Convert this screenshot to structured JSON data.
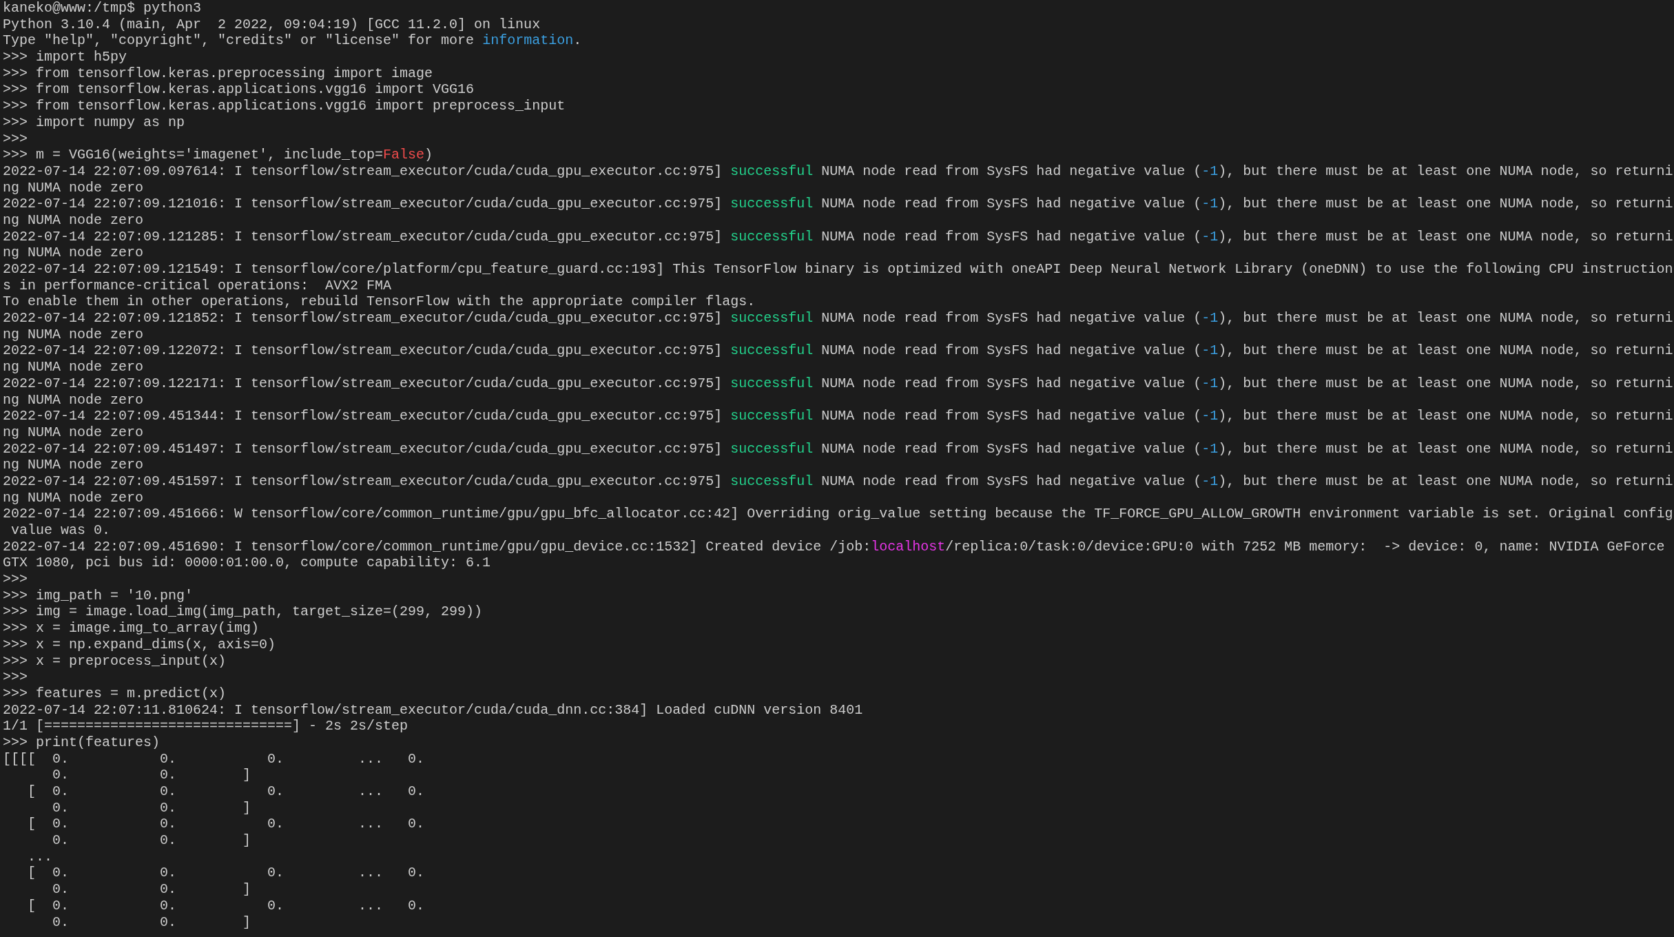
{
  "terminal": {
    "lines": [
      {
        "segments": [
          {
            "text": "kaneko@www:/tmp$ python3"
          }
        ]
      },
      {
        "segments": [
          {
            "text": "Python 3.10.4 (main, Apr  2 2022, 09:04:19) [GCC 11.2.0] on linux"
          }
        ]
      },
      {
        "segments": [
          {
            "text": "Type \"help\", \"copyright\", \"credits\" or \"license\" for more "
          },
          {
            "text": "information",
            "color": "#3b9fe0"
          },
          {
            "text": "."
          }
        ]
      },
      {
        "segments": [
          {
            "text": ">>> import h5py"
          }
        ]
      },
      {
        "segments": [
          {
            "text": ">>> from tensorflow.keras.preprocessing import image"
          }
        ]
      },
      {
        "segments": [
          {
            "text": ">>> from tensorflow.keras.applications.vgg16 import VGG16"
          }
        ]
      },
      {
        "segments": [
          {
            "text": ">>> from tensorflow.keras.applications.vgg16 import preprocess_input"
          }
        ]
      },
      {
        "segments": [
          {
            "text": ">>> import numpy as np"
          }
        ]
      },
      {
        "segments": [
          {
            "text": ">>>"
          }
        ]
      },
      {
        "segments": [
          {
            "text": ">>> m = VGG16(weights='imagenet', include_top="
          },
          {
            "text": "False",
            "color": "#f14c4c"
          },
          {
            "text": ")"
          }
        ]
      },
      {
        "segments": [
          {
            "text": "2022-07-14 22:07:09.097614: I tensorflow/stream_executor/cuda/cuda_gpu_executor.cc:975] "
          },
          {
            "text": "successful",
            "color": "#23d18b"
          },
          {
            "text": " NUMA node read from SysFS had negative value ("
          },
          {
            "text": "-1",
            "color": "#3b9fe0"
          },
          {
            "text": "), but there must be at least one NUMA node, so returni"
          }
        ]
      },
      {
        "segments": [
          {
            "text": "ng NUMA node zero"
          }
        ]
      },
      {
        "segments": [
          {
            "text": "2022-07-14 22:07:09.121016: I tensorflow/stream_executor/cuda/cuda_gpu_executor.cc:975] "
          },
          {
            "text": "successful",
            "color": "#23d18b"
          },
          {
            "text": " NUMA node read from SysFS had negative value ("
          },
          {
            "text": "-1",
            "color": "#3b9fe0"
          },
          {
            "text": "), but there must be at least one NUMA node, so returni"
          }
        ]
      },
      {
        "segments": [
          {
            "text": "ng NUMA node zero"
          }
        ]
      },
      {
        "segments": [
          {
            "text": "2022-07-14 22:07:09.121285: I tensorflow/stream_executor/cuda/cuda_gpu_executor.cc:975] "
          },
          {
            "text": "successful",
            "color": "#23d18b"
          },
          {
            "text": " NUMA node read from SysFS had negative value ("
          },
          {
            "text": "-1",
            "color": "#3b9fe0"
          },
          {
            "text": "), but there must be at least one NUMA node, so returni"
          }
        ]
      },
      {
        "segments": [
          {
            "text": "ng NUMA node zero"
          }
        ]
      },
      {
        "segments": [
          {
            "text": "2022-07-14 22:07:09.121549: I tensorflow/core/platform/cpu_feature_guard.cc:193] This TensorFlow binary is optimized with oneAPI Deep Neural Network Library (oneDNN) to use the following CPU instruction"
          }
        ]
      },
      {
        "segments": [
          {
            "text": "s in performance-critical operations:  AVX2 FMA"
          }
        ]
      },
      {
        "segments": [
          {
            "text": "To enable them in other operations, rebuild TensorFlow with the appropriate compiler flags."
          }
        ]
      },
      {
        "segments": [
          {
            "text": "2022-07-14 22:07:09.121852: I tensorflow/stream_executor/cuda/cuda_gpu_executor.cc:975] "
          },
          {
            "text": "successful",
            "color": "#23d18b"
          },
          {
            "text": " NUMA node read from SysFS had negative value ("
          },
          {
            "text": "-1",
            "color": "#3b9fe0"
          },
          {
            "text": "), but there must be at least one NUMA node, so returni"
          }
        ]
      },
      {
        "segments": [
          {
            "text": "ng NUMA node zero"
          }
        ]
      },
      {
        "segments": [
          {
            "text": "2022-07-14 22:07:09.122072: I tensorflow/stream_executor/cuda/cuda_gpu_executor.cc:975] "
          },
          {
            "text": "successful",
            "color": "#23d18b"
          },
          {
            "text": " NUMA node read from SysFS had negative value ("
          },
          {
            "text": "-1",
            "color": "#3b9fe0"
          },
          {
            "text": "), but there must be at least one NUMA node, so returni"
          }
        ]
      },
      {
        "segments": [
          {
            "text": "ng NUMA node zero"
          }
        ]
      },
      {
        "segments": [
          {
            "text": "2022-07-14 22:07:09.122171: I tensorflow/stream_executor/cuda/cuda_gpu_executor.cc:975] "
          },
          {
            "text": "successful",
            "color": "#23d18b"
          },
          {
            "text": " NUMA node read from SysFS had negative value ("
          },
          {
            "text": "-1",
            "color": "#3b9fe0"
          },
          {
            "text": "), but there must be at least one NUMA node, so returni"
          }
        ]
      },
      {
        "segments": [
          {
            "text": "ng NUMA node zero"
          }
        ]
      },
      {
        "segments": [
          {
            "text": "2022-07-14 22:07:09.451344: I tensorflow/stream_executor/cuda/cuda_gpu_executor.cc:975] "
          },
          {
            "text": "successful",
            "color": "#23d18b"
          },
          {
            "text": " NUMA node read from SysFS had negative value ("
          },
          {
            "text": "-1",
            "color": "#3b9fe0"
          },
          {
            "text": "), but there must be at least one NUMA node, so returni"
          }
        ]
      },
      {
        "segments": [
          {
            "text": "ng NUMA node zero"
          }
        ]
      },
      {
        "segments": [
          {
            "text": "2022-07-14 22:07:09.451497: I tensorflow/stream_executor/cuda/cuda_gpu_executor.cc:975] "
          },
          {
            "text": "successful",
            "color": "#23d18b"
          },
          {
            "text": " NUMA node read from SysFS had negative value ("
          },
          {
            "text": "-1",
            "color": "#3b9fe0"
          },
          {
            "text": "), but there must be at least one NUMA node, so returni"
          }
        ]
      },
      {
        "segments": [
          {
            "text": "ng NUMA node zero"
          }
        ]
      },
      {
        "segments": [
          {
            "text": "2022-07-14 22:07:09.451597: I tensorflow/stream_executor/cuda/cuda_gpu_executor.cc:975] "
          },
          {
            "text": "successful",
            "color": "#23d18b"
          },
          {
            "text": " NUMA node read from SysFS had negative value ("
          },
          {
            "text": "-1",
            "color": "#3b9fe0"
          },
          {
            "text": "), but there must be at least one NUMA node, so returni"
          }
        ]
      },
      {
        "segments": [
          {
            "text": "ng NUMA node zero"
          }
        ]
      },
      {
        "segments": [
          {
            "text": "2022-07-14 22:07:09.451666: W tensorflow/core/common_runtime/gpu/gpu_bfc_allocator.cc:42] Overriding orig_value setting because the TF_FORCE_GPU_ALLOW_GROWTH environment variable is set. Original config"
          }
        ]
      },
      {
        "segments": [
          {
            "text": " value was 0."
          }
        ]
      },
      {
        "segments": [
          {
            "text": "2022-07-14 22:07:09.451690: I tensorflow/core/common_runtime/gpu/gpu_device.cc:1532] Created device /job:"
          },
          {
            "text": "localhost",
            "color": "#e535e5"
          },
          {
            "text": "/replica:0/task:0/device:GPU:0 with 7252 MB memory:  -> device: 0, name: NVIDIA GeForce"
          }
        ]
      },
      {
        "segments": [
          {
            "text": "GTX 1080, pci bus id: 0000:01:00.0, compute capability: 6.1"
          }
        ]
      },
      {
        "segments": [
          {
            "text": ">>>"
          }
        ]
      },
      {
        "segments": [
          {
            "text": ">>> img_path = '10.png'"
          }
        ]
      },
      {
        "segments": [
          {
            "text": ">>> img = image.load_img(img_path, target_size=(299, 299))"
          }
        ]
      },
      {
        "segments": [
          {
            "text": ">>> x = image.img_to_array(img)"
          }
        ]
      },
      {
        "segments": [
          {
            "text": ">>> x = np.expand_dims(x, axis=0)"
          }
        ]
      },
      {
        "segments": [
          {
            "text": ">>> x = preprocess_input(x)"
          }
        ]
      },
      {
        "segments": [
          {
            "text": ">>>"
          }
        ]
      },
      {
        "segments": [
          {
            "text": ">>> features = m.predict(x)"
          }
        ]
      },
      {
        "segments": [
          {
            "text": "2022-07-14 22:07:11.810624: I tensorflow/stream_executor/cuda/cuda_dnn.cc:384] Loaded cuDNN version 8401"
          }
        ]
      },
      {
        "segments": [
          {
            "text": "1/1 [==============================] - 2s 2s/step"
          }
        ]
      },
      {
        "segments": [
          {
            "text": ">>> print(features)"
          }
        ]
      },
      {
        "segments": [
          {
            "text": "[[[[  0.           0.           0.         ...   0."
          }
        ]
      },
      {
        "segments": [
          {
            "text": "      0.           0.        ]"
          }
        ]
      },
      {
        "segments": [
          {
            "text": "   [  0.           0.           0.         ...   0."
          }
        ]
      },
      {
        "segments": [
          {
            "text": "      0.           0.        ]"
          }
        ]
      },
      {
        "segments": [
          {
            "text": "   [  0.           0.           0.         ...   0."
          }
        ]
      },
      {
        "segments": [
          {
            "text": "      0.           0.        ]"
          }
        ]
      },
      {
        "segments": [
          {
            "text": "   ..."
          }
        ]
      },
      {
        "segments": [
          {
            "text": "   [  0.           0.           0.         ...   0."
          }
        ]
      },
      {
        "segments": [
          {
            "text": "      0.           0.        ]"
          }
        ]
      },
      {
        "segments": [
          {
            "text": "   [  0.           0.           0.         ...   0."
          }
        ]
      },
      {
        "segments": [
          {
            "text": "      0.           0.        ]"
          }
        ]
      }
    ]
  }
}
